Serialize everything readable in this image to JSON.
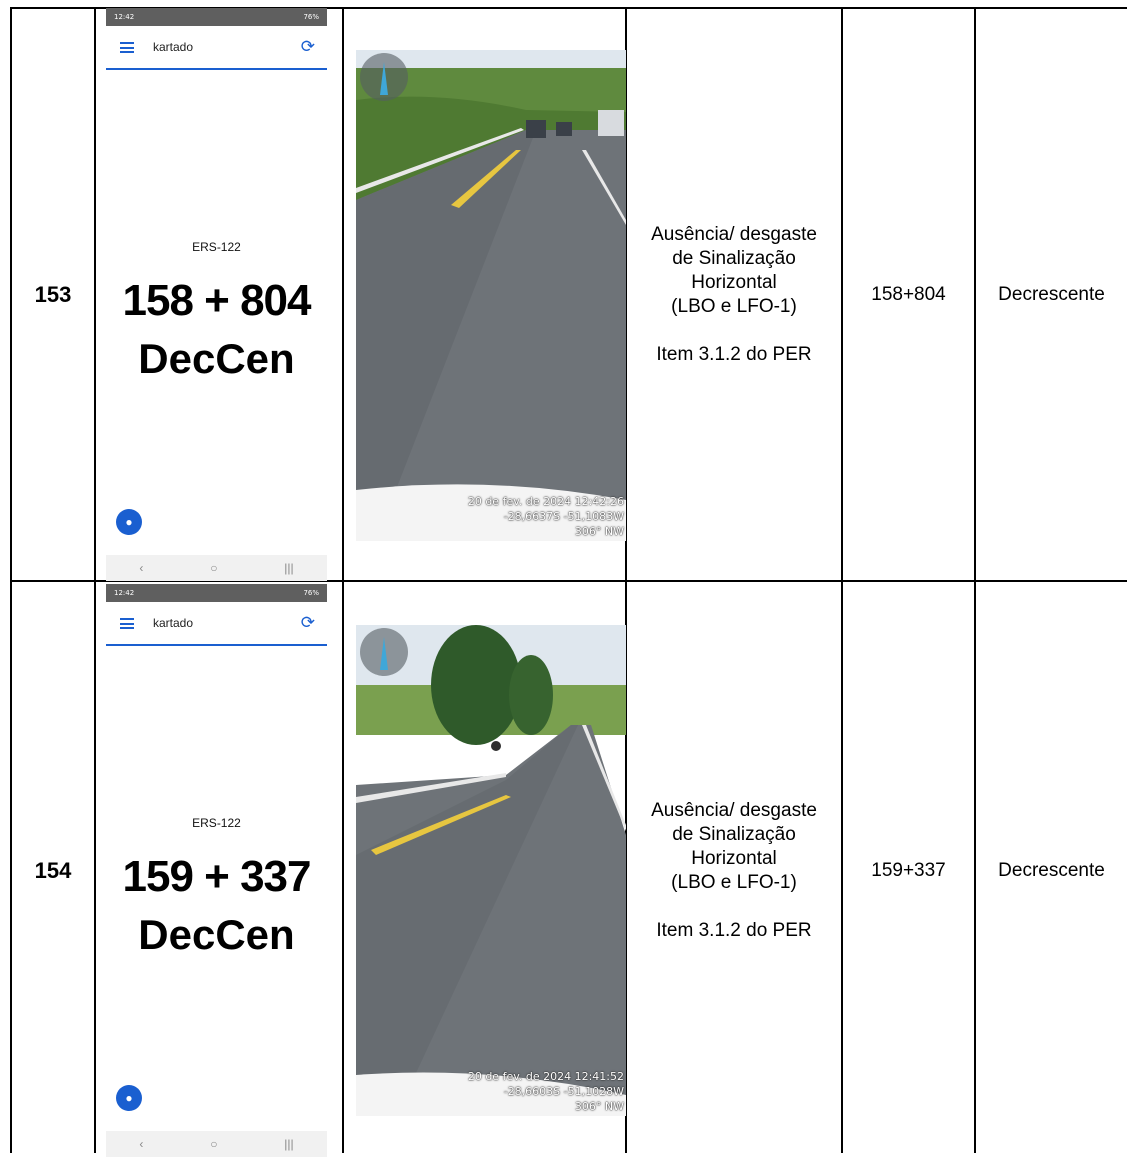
{
  "rows": [
    {
      "number": "153",
      "phone": {
        "status_time": "12:42",
        "status_right": "76%",
        "app_title": "kartado",
        "road_code": "ERS-122",
        "km_big": "158 + 804",
        "km_sub": "DecCen"
      },
      "photo": {
        "date": "20 de fev. de 2024 12:42:26",
        "coords": "-28,6637S -51,1083W",
        "heading": "306° NW"
      },
      "description": {
        "line1": "Ausência/ desgaste",
        "line2": "de Sinalização",
        "line3": "Horizontal",
        "line4": "(LBO e LFO-1)",
        "item": "Item 3.1.2 do PER"
      },
      "km": "158+804",
      "direction": "Decrescente"
    },
    {
      "number": "154",
      "phone": {
        "status_time": "12:42",
        "status_right": "76%",
        "app_title": "kartado",
        "road_code": "ERS-122",
        "km_big": "159 + 337",
        "km_sub": "DecCen"
      },
      "photo": {
        "date": "20 de fev. de 2024 12:41:52",
        "coords": "-28,6603S -51,1028W",
        "heading": "306° NW"
      },
      "description": {
        "line1": "Ausência/ desgaste",
        "line2": "de Sinalização",
        "line3": "Horizontal",
        "line4": "(LBO e LFO-1)",
        "item": "Item 3.1.2 do PER"
      },
      "km": "159+337",
      "direction": "Decrescente"
    }
  ],
  "icons": {
    "menu": "hamburger-icon",
    "sync": "sync-icon",
    "location": "location-pin-icon",
    "compass": "compass-icon"
  },
  "colors": {
    "accent": "#1a5fd0",
    "status_bar": "#5f5f5f"
  }
}
